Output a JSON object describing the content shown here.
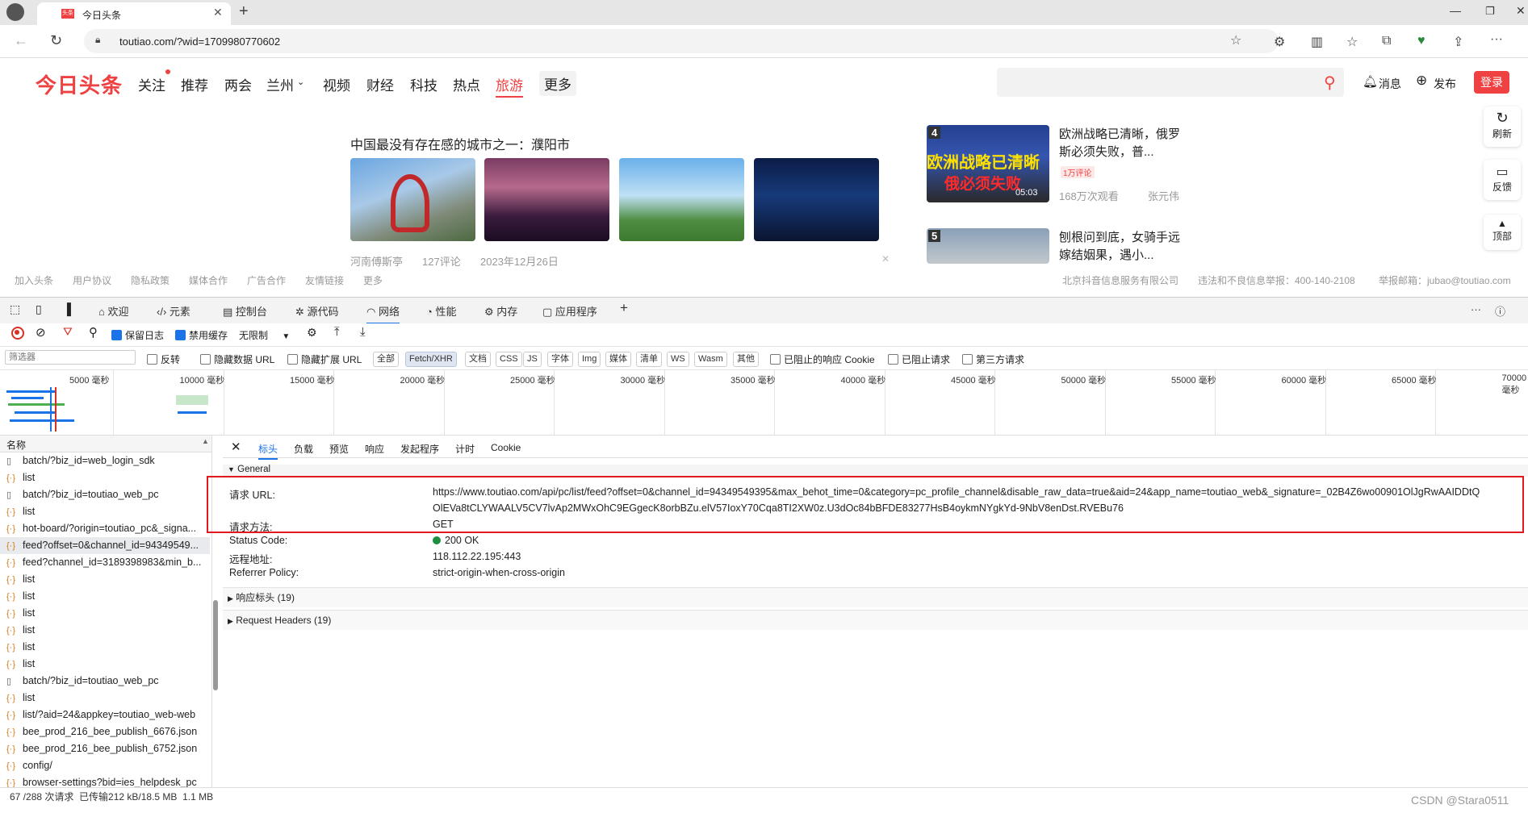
{
  "browser": {
    "tab_title": "今日头条",
    "tab_badge": "头条",
    "url": "toutiao.com/?wid=1709980770602"
  },
  "site": {
    "logo": "今日头条",
    "nav": [
      "关注",
      "推荐",
      "两会",
      "兰州",
      "视频",
      "财经",
      "科技",
      "热点",
      "旅游",
      "更多"
    ],
    "message": "消息",
    "publish": "发布",
    "login": "登录",
    "article": {
      "title": "中国最没有存在感的城市之一：濮阳市",
      "source": "河南傅斯亭",
      "comments": "127评论",
      "date": "2023年12月26日"
    },
    "hot": [
      {
        "rank": "4",
        "title": "欧洲战略已清晰，俄罗斯必须失败，普...",
        "tag": "1万评论",
        "views": "168万次观看",
        "author": "张元伟",
        "duration": "05:03",
        "overlay": "欧洲战略已清晰",
        "overlay2": "俄必须失败"
      },
      {
        "rank": "5",
        "title": "刨根问到底，女骑手远嫁结姻果，遇小..."
      }
    ],
    "side": [
      "刷新",
      "反馈",
      "顶部"
    ],
    "footer": [
      "加入头条",
      "用户协议",
      "隐私政策",
      "媒体合作",
      "广告合作",
      "友情链接",
      "更多"
    ],
    "footer_right": [
      "北京抖音信息服务有限公司",
      "违法和不良信息举报：400-140-2108",
      "举报邮箱：jubao@toutiao.com"
    ]
  },
  "devtools": {
    "tabs": [
      "欢迎",
      "元素",
      "控制台",
      "源代码",
      "网络",
      "性能",
      "内存",
      "应用程序"
    ],
    "active_tab": "网络",
    "toolbar": {
      "preserve_log": "保留日志",
      "disable_cache": "禁用缓存",
      "throttle": "无限制"
    },
    "filter": {
      "placeholder": "筛选器",
      "invert": "反转",
      "hide_data_url": "隐藏数据 URL",
      "hide_ext_url": "隐藏扩展 URL",
      "types": [
        "全部",
        "Fetch/XHR",
        "文档",
        "CSS",
        "JS",
        "字体",
        "Img",
        "媒体",
        "清单",
        "WS",
        "Wasm",
        "其他"
      ],
      "active_type": "Fetch/XHR",
      "blocked_cookie": "已阻止的响应 Cookie",
      "blocked_req": "已阻止请求",
      "third_party": "第三方请求"
    },
    "timeline_ticks": [
      "5000 毫秒",
      "10000 毫秒",
      "15000 毫秒",
      "20000 毫秒",
      "25000 毫秒",
      "30000 毫秒",
      "35000 毫秒",
      "40000 毫秒",
      "45000 毫秒",
      "50000 毫秒",
      "55000 毫秒",
      "60000 毫秒",
      "65000 毫秒",
      "70000 毫秒"
    ],
    "list_header": "名称",
    "requests": [
      {
        "icon": "doc",
        "name": "batch/?biz_id=web_login_sdk"
      },
      {
        "icon": "xhr",
        "name": "list"
      },
      {
        "icon": "doc",
        "name": "batch/?biz_id=toutiao_web_pc"
      },
      {
        "icon": "xhr",
        "name": "list"
      },
      {
        "icon": "xhr",
        "name": "hot-board/?origin=toutiao_pc&_signa..."
      },
      {
        "icon": "xhr",
        "name": "feed?offset=0&channel_id=94349549...",
        "selected": true
      },
      {
        "icon": "xhr",
        "name": "feed?channel_id=3189398983&min_b..."
      },
      {
        "icon": "xhr",
        "name": "list"
      },
      {
        "icon": "xhr",
        "name": "list"
      },
      {
        "icon": "xhr",
        "name": "list"
      },
      {
        "icon": "xhr",
        "name": "list"
      },
      {
        "icon": "xhr",
        "name": "list"
      },
      {
        "icon": "xhr",
        "name": "list"
      },
      {
        "icon": "doc",
        "name": "batch/?biz_id=toutiao_web_pc"
      },
      {
        "icon": "xhr",
        "name": "list"
      },
      {
        "icon": "xhr",
        "name": "list/?aid=24&appkey=toutiao_web-web"
      },
      {
        "icon": "xhr",
        "name": "bee_prod_216_bee_publish_6676.json"
      },
      {
        "icon": "xhr",
        "name": "bee_prod_216_bee_publish_6752.json"
      },
      {
        "icon": "xhr",
        "name": "config/"
      },
      {
        "icon": "xhr",
        "name": "browser-settings?bid=ies_helpdesk_pc"
      }
    ],
    "detail_tabs": [
      "标头",
      "负载",
      "预览",
      "响应",
      "发起程序",
      "计时",
      "Cookie"
    ],
    "active_detail_tab": "标头",
    "general": {
      "section": "General",
      "url_label": "请求 URL:",
      "url_line1": "https://www.toutiao.com/api/pc/list/feed?offset=0&channel_id=94349549395&max_behot_time=0&category=pc_profile_channel&disable_raw_data=true&aid=24&app_name=toutiao_web&_signature=_02B4Z6wo00901OlJgRwAAIDDtQ",
      "url_line2": "OlEVa8tCLYWAALV5CV7lvAp2MWxOhC9EGgecK8orbBZu.elV57IoxY70Cqa8TI2XW0z.U3dOc84bBFDE83277HsB4oykmNYgkYd-9NbV8enDst.RVEBu76",
      "method_label": "请求方法:",
      "method": "GET",
      "status_label": "Status Code:",
      "status": "200 OK",
      "remote_label": "远程地址:",
      "remote": "118.112.22.195:443",
      "referrer_label": "Referrer Policy:",
      "referrer": "strict-origin-when-cross-origin"
    },
    "response_headers": "响应标头 (19)",
    "request_headers": "Request Headers (19)",
    "status_bar": "67 /288 次请求  已传输212 kB/18.5 MB  1.1 MB",
    "watermark": "CSDN @Stara0511"
  }
}
